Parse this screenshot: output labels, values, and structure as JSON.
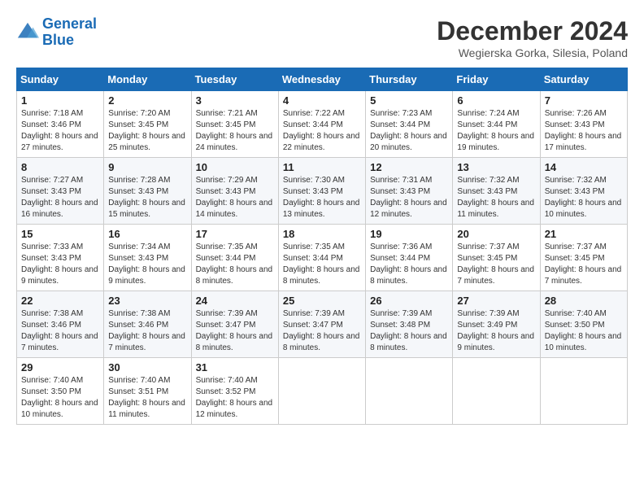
{
  "logo": {
    "line1": "General",
    "line2": "Blue"
  },
  "title": "December 2024",
  "location": "Wegierska Gorka, Silesia, Poland",
  "days_of_week": [
    "Sunday",
    "Monday",
    "Tuesday",
    "Wednesday",
    "Thursday",
    "Friday",
    "Saturday"
  ],
  "weeks": [
    [
      {
        "day": "1",
        "sunrise": "7:18 AM",
        "sunset": "3:46 PM",
        "daylight": "8 hours and 27 minutes."
      },
      {
        "day": "2",
        "sunrise": "7:20 AM",
        "sunset": "3:45 PM",
        "daylight": "8 hours and 25 minutes."
      },
      {
        "day": "3",
        "sunrise": "7:21 AM",
        "sunset": "3:45 PM",
        "daylight": "8 hours and 24 minutes."
      },
      {
        "day": "4",
        "sunrise": "7:22 AM",
        "sunset": "3:44 PM",
        "daylight": "8 hours and 22 minutes."
      },
      {
        "day": "5",
        "sunrise": "7:23 AM",
        "sunset": "3:44 PM",
        "daylight": "8 hours and 20 minutes."
      },
      {
        "day": "6",
        "sunrise": "7:24 AM",
        "sunset": "3:44 PM",
        "daylight": "8 hours and 19 minutes."
      },
      {
        "day": "7",
        "sunrise": "7:26 AM",
        "sunset": "3:43 PM",
        "daylight": "8 hours and 17 minutes."
      }
    ],
    [
      {
        "day": "8",
        "sunrise": "7:27 AM",
        "sunset": "3:43 PM",
        "daylight": "8 hours and 16 minutes."
      },
      {
        "day": "9",
        "sunrise": "7:28 AM",
        "sunset": "3:43 PM",
        "daylight": "8 hours and 15 minutes."
      },
      {
        "day": "10",
        "sunrise": "7:29 AM",
        "sunset": "3:43 PM",
        "daylight": "8 hours and 14 minutes."
      },
      {
        "day": "11",
        "sunrise": "7:30 AM",
        "sunset": "3:43 PM",
        "daylight": "8 hours and 13 minutes."
      },
      {
        "day": "12",
        "sunrise": "7:31 AM",
        "sunset": "3:43 PM",
        "daylight": "8 hours and 12 minutes."
      },
      {
        "day": "13",
        "sunrise": "7:32 AM",
        "sunset": "3:43 PM",
        "daylight": "8 hours and 11 minutes."
      },
      {
        "day": "14",
        "sunrise": "7:32 AM",
        "sunset": "3:43 PM",
        "daylight": "8 hours and 10 minutes."
      }
    ],
    [
      {
        "day": "15",
        "sunrise": "7:33 AM",
        "sunset": "3:43 PM",
        "daylight": "8 hours and 9 minutes."
      },
      {
        "day": "16",
        "sunrise": "7:34 AM",
        "sunset": "3:43 PM",
        "daylight": "8 hours and 9 minutes."
      },
      {
        "day": "17",
        "sunrise": "7:35 AM",
        "sunset": "3:44 PM",
        "daylight": "8 hours and 8 minutes."
      },
      {
        "day": "18",
        "sunrise": "7:35 AM",
        "sunset": "3:44 PM",
        "daylight": "8 hours and 8 minutes."
      },
      {
        "day": "19",
        "sunrise": "7:36 AM",
        "sunset": "3:44 PM",
        "daylight": "8 hours and 8 minutes."
      },
      {
        "day": "20",
        "sunrise": "7:37 AM",
        "sunset": "3:45 PM",
        "daylight": "8 hours and 7 minutes."
      },
      {
        "day": "21",
        "sunrise": "7:37 AM",
        "sunset": "3:45 PM",
        "daylight": "8 hours and 7 minutes."
      }
    ],
    [
      {
        "day": "22",
        "sunrise": "7:38 AM",
        "sunset": "3:46 PM",
        "daylight": "8 hours and 7 minutes."
      },
      {
        "day": "23",
        "sunrise": "7:38 AM",
        "sunset": "3:46 PM",
        "daylight": "8 hours and 7 minutes."
      },
      {
        "day": "24",
        "sunrise": "7:39 AM",
        "sunset": "3:47 PM",
        "daylight": "8 hours and 8 minutes."
      },
      {
        "day": "25",
        "sunrise": "7:39 AM",
        "sunset": "3:47 PM",
        "daylight": "8 hours and 8 minutes."
      },
      {
        "day": "26",
        "sunrise": "7:39 AM",
        "sunset": "3:48 PM",
        "daylight": "8 hours and 8 minutes."
      },
      {
        "day": "27",
        "sunrise": "7:39 AM",
        "sunset": "3:49 PM",
        "daylight": "8 hours and 9 minutes."
      },
      {
        "day": "28",
        "sunrise": "7:40 AM",
        "sunset": "3:50 PM",
        "daylight": "8 hours and 10 minutes."
      }
    ],
    [
      {
        "day": "29",
        "sunrise": "7:40 AM",
        "sunset": "3:50 PM",
        "daylight": "8 hours and 10 minutes."
      },
      {
        "day": "30",
        "sunrise": "7:40 AM",
        "sunset": "3:51 PM",
        "daylight": "8 hours and 11 minutes."
      },
      {
        "day": "31",
        "sunrise": "7:40 AM",
        "sunset": "3:52 PM",
        "daylight": "8 hours and 12 minutes."
      },
      null,
      null,
      null,
      null
    ]
  ],
  "labels": {
    "sunrise": "Sunrise:",
    "sunset": "Sunset:",
    "daylight": "Daylight:"
  }
}
